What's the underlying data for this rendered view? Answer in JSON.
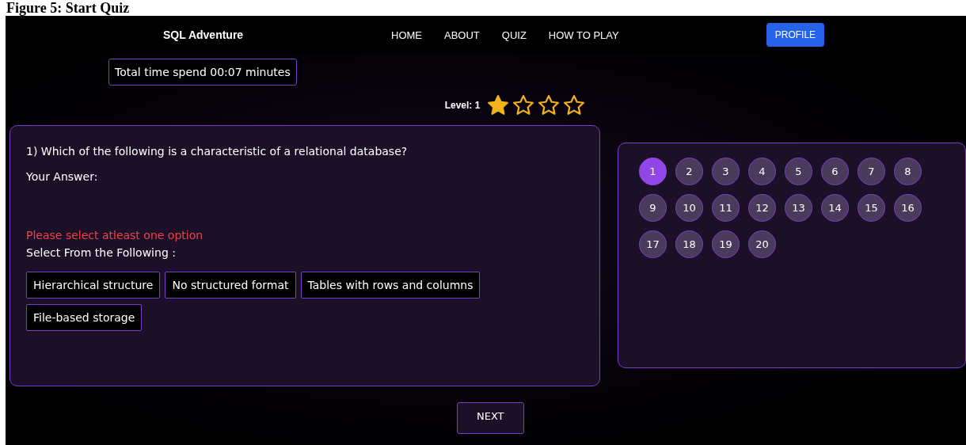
{
  "caption": "Figure 5: Start Quiz",
  "navbar": {
    "brand": "SQL Adventure",
    "links": [
      "HOME",
      "ABOUT",
      "QUIZ",
      "HOW TO PLAY"
    ],
    "profile_button": "PROFILE"
  },
  "timer": "Total time spend 00:07 minutes",
  "level": {
    "label": "Level: 1",
    "stars": 1
  },
  "question": {
    "text": "1) Which of the following is a characteristic of a relational database?",
    "answer_label": "Your Answer:",
    "error": "Please select atleast one option",
    "prompt": "Select From the Following :",
    "options": [
      {
        "label": "Hierarchical structure",
        "selected": false
      },
      {
        "label": "No structured format",
        "selected": false
      },
      {
        "label": "Tables with rows and columns",
        "selected": false
      },
      {
        "label": "File-based storage",
        "selected": false
      }
    ]
  },
  "question_numbers": [
    {
      "label": "1",
      "selected": true
    },
    {
      "label": "2",
      "selected": false
    },
    {
      "label": "3",
      "selected": false
    },
    {
      "label": "4",
      "selected": false
    },
    {
      "label": "5",
      "selected": false
    },
    {
      "label": "6",
      "selected": false
    },
    {
      "label": "7",
      "selected": false
    },
    {
      "label": "8",
      "selected": false
    },
    {
      "label": "9",
      "selected": false
    },
    {
      "label": "10",
      "selected": false
    },
    {
      "label": "11",
      "selected": false
    },
    {
      "label": "12",
      "selected": false
    },
    {
      "label": "13",
      "selected": false
    },
    {
      "label": "14",
      "selected": false
    },
    {
      "label": "15",
      "selected": false
    },
    {
      "label": "16",
      "selected": false
    },
    {
      "label": "17",
      "selected": false
    },
    {
      "label": "18",
      "selected": false
    },
    {
      "label": "19",
      "selected": false
    },
    {
      "label": "20",
      "selected": false
    }
  ],
  "next_button": "NEXT"
}
